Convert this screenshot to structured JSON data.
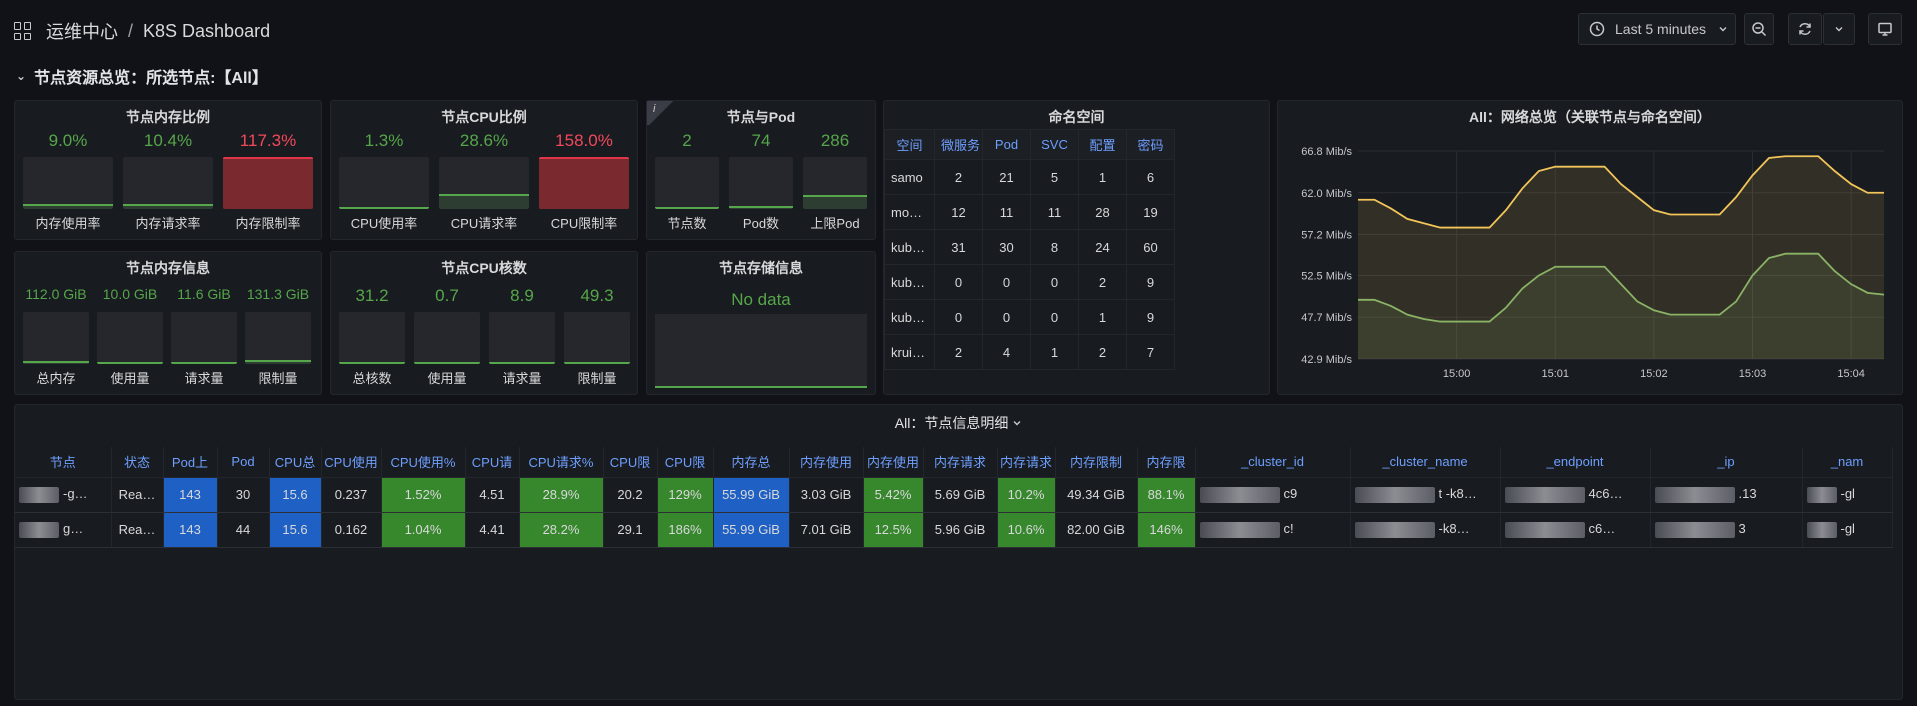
{
  "header": {
    "folder": "运维中心",
    "separator": "/",
    "title": "K8S Dashboard",
    "time_range": "Last 5 minutes"
  },
  "row": {
    "title": "节点资源总览：所选节点:【All】"
  },
  "mem_ratio": {
    "title": "节点内存比例",
    "gauges": [
      {
        "value": "9.0%",
        "label": "内存使用率",
        "level": 0.09,
        "state": "ok"
      },
      {
        "value": "10.4%",
        "label": "内存请求率",
        "level": 0.104,
        "state": "ok"
      },
      {
        "value": "117.3%",
        "label": "内存限制率",
        "level": 1.0,
        "state": "over"
      }
    ]
  },
  "cpu_ratio": {
    "title": "节点CPU比例",
    "gauges": [
      {
        "value": "1.3%",
        "label": "CPU使用率",
        "level": 0.013,
        "state": "ok"
      },
      {
        "value": "28.6%",
        "label": "CPU请求率",
        "level": 0.286,
        "state": "ok"
      },
      {
        "value": "158.0%",
        "label": "CPU限制率",
        "level": 1.0,
        "state": "over"
      }
    ]
  },
  "node_pod": {
    "title": "节点与Pod",
    "info": "i",
    "gauges": [
      {
        "value": "2",
        "label": "节点数",
        "level": 0.02
      },
      {
        "value": "74",
        "label": "Pod数",
        "level": 0.05
      },
      {
        "value": "286",
        "label": "上限Pod",
        "level": 0.26
      }
    ]
  },
  "mem_info": {
    "title": "节点内存信息",
    "gauges": [
      {
        "value": "112.0 GiB",
        "label": "总内存",
        "level": 0.05
      },
      {
        "value": "10.0 GiB",
        "label": "使用量",
        "level": 0.02
      },
      {
        "value": "11.6 GiB",
        "label": "请求量",
        "level": 0.02
      },
      {
        "value": "131.3 GiB",
        "label": "限制量",
        "level": 0.08
      }
    ]
  },
  "cpu_cores": {
    "title": "节点CPU核数",
    "gauges": [
      {
        "value": "31.2",
        "label": "总核数",
        "level": 0.03
      },
      {
        "value": "0.7",
        "label": "使用量",
        "level": 0.02
      },
      {
        "value": "8.9",
        "label": "请求量",
        "level": 0.02
      },
      {
        "value": "49.3",
        "label": "限制量",
        "level": 0.04
      }
    ]
  },
  "storage": {
    "title": "节点存储信息",
    "no_data": "No data"
  },
  "namespace": {
    "title": "命名空间",
    "columns": [
      "空间",
      "微服务",
      "Pod",
      "SVC",
      "配置",
      "密码"
    ],
    "rows": [
      [
        "samo",
        "2",
        "21",
        "5",
        "1",
        "6"
      ],
      [
        "mo…",
        "12",
        "11",
        "11",
        "28",
        "19"
      ],
      [
        "kub…",
        "31",
        "30",
        "8",
        "24",
        "60"
      ],
      [
        "kub…",
        "0",
        "0",
        "0",
        "2",
        "9"
      ],
      [
        "kub…",
        "0",
        "0",
        "0",
        "1",
        "9"
      ],
      [
        "krui…",
        "2",
        "4",
        "1",
        "2",
        "7"
      ]
    ]
  },
  "network": {
    "title": "All：网络总览（关联节点与命名空间）"
  },
  "chart_data": {
    "type": "area",
    "title": "All：网络总览（关联节点与命名空间）",
    "x": [
      "14:59:35",
      "14:59:45",
      "14:59:55",
      "15:00:05",
      "15:00:15",
      "15:00:25",
      "15:00:35",
      "15:00:45",
      "15:00:55",
      "15:01:05",
      "15:01:15",
      "15:01:25",
      "15:01:35",
      "15:01:45",
      "15:01:55",
      "15:02:05",
      "15:02:15",
      "15:02:25",
      "15:02:35",
      "15:02:45",
      "15:02:55",
      "15:03:05",
      "15:03:15",
      "15:03:25",
      "15:03:35",
      "15:03:45",
      "15:03:55",
      "15:04:05",
      "15:04:15"
    ],
    "xticks": [
      "15:00",
      "15:01",
      "15:02",
      "15:03",
      "15:04"
    ],
    "yticks": [
      "42.9 Mib/s",
      "47.7 Mib/s",
      "52.5 Mib/s",
      "57.2 Mib/s",
      "62.0 Mib/s",
      "66.8 Mib/s"
    ],
    "ylim": [
      42.9,
      66.8
    ],
    "series": [
      {
        "color": "#f2c55a",
        "values": [
          61.2,
          61.2,
          60.2,
          59.0,
          58.5,
          58.0,
          58.0,
          58.0,
          58.0,
          60.0,
          62.5,
          64.5,
          65.0,
          65.0,
          65.0,
          65.0,
          63.0,
          61.5,
          60.0,
          59.5,
          59.5,
          59.5,
          59.5,
          61.5,
          64.0,
          66.0,
          66.2,
          66.2,
          66.2,
          64.5,
          63.0,
          62.0,
          62.0
        ]
      },
      {
        "color": "#8ab366",
        "values": [
          49.7,
          49.7,
          49.0,
          48.0,
          47.5,
          47.2,
          47.2,
          47.2,
          47.2,
          48.8,
          51.0,
          52.5,
          53.5,
          53.5,
          53.5,
          53.5,
          51.5,
          49.5,
          48.5,
          48.0,
          48.0,
          48.0,
          48.0,
          49.5,
          52.5,
          54.5,
          55.0,
          55.0,
          55.0,
          53.0,
          51.5,
          50.5,
          50.3
        ]
      }
    ]
  },
  "details": {
    "title": "All：节点信息明细",
    "columns": [
      "节点",
      "状态",
      "Pod上",
      "Pod",
      "CPU总",
      "CPU使用",
      "CPU使用%",
      "CPU请",
      "CPU请求%",
      "CPU限",
      "CPU限",
      "内存总",
      "内存使用",
      "内存使用",
      "内存请求",
      "内存请求",
      "内存限制",
      "内存限",
      "_cluster_id",
      "_cluster_name",
      "_endpoint",
      "_ip",
      "_nam"
    ],
    "rows": [
      [
        "-g…",
        "Rea…",
        "143",
        "30",
        "15.6",
        "0.237",
        "1.52%",
        "4.51",
        "28.9%",
        "20.2",
        "129%",
        "55.99 GiB",
        "3.03 GiB",
        "5.42%",
        "5.69 GiB",
        "10.2%",
        "49.34 GiB",
        "88.1%",
        "c9",
        "t    -k8…",
        "4c6…",
        ".13",
        "-gl"
      ],
      [
        "g…",
        "Rea…",
        "143",
        "44",
        "15.6",
        "0.162",
        "1.04%",
        "4.41",
        "28.2%",
        "29.1",
        "186%",
        "55.99 GiB",
        "7.01 GiB",
        "12.5%",
        "5.96 GiB",
        "10.6%",
        "82.00 GiB",
        "146%",
        "c!",
        "-k8…",
        "c6…",
        "3",
        "-gl"
      ]
    ]
  }
}
